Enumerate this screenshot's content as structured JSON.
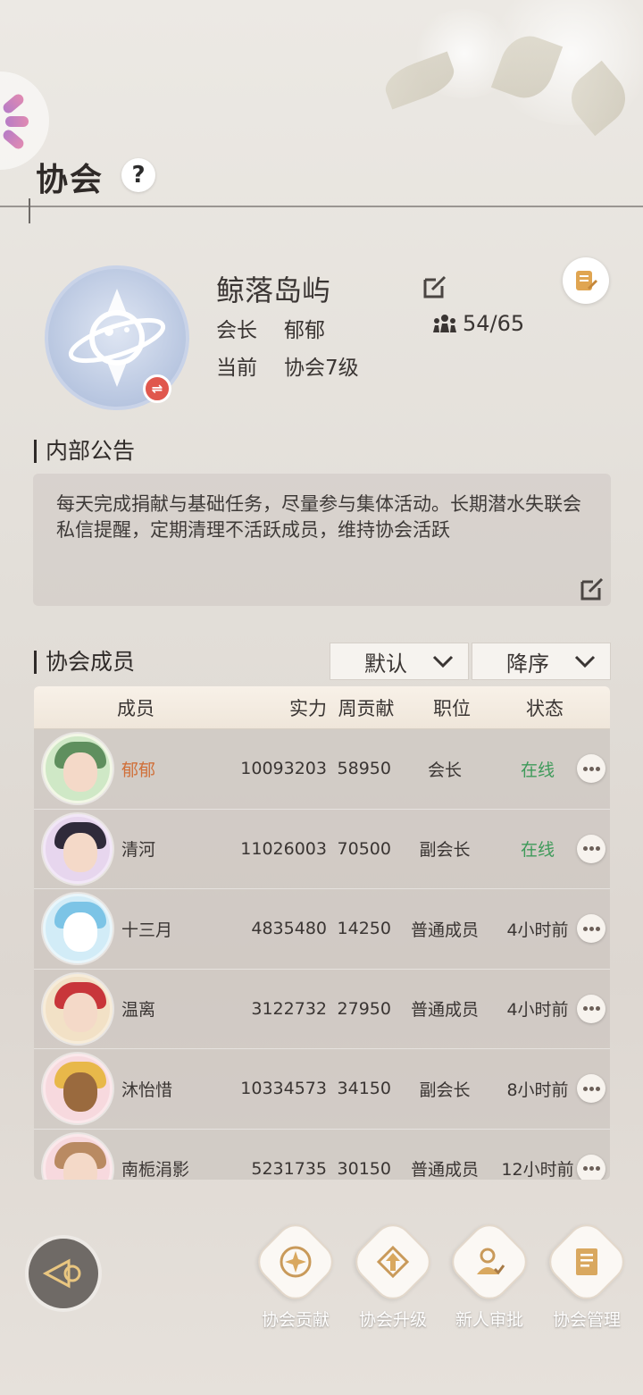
{
  "header": {
    "title": "协会",
    "help_label": "?"
  },
  "guild": {
    "name": "鲸落岛屿",
    "leader_key": "会长",
    "leader_value": "郁郁",
    "level_key": "当前",
    "level_value": "协会7级",
    "member_count": "54/65",
    "swap_label": "⇌"
  },
  "notice": {
    "title": "内部公告",
    "text": "每天完成捐献与基础任务，尽量参与集体活动。长期潜水失联会私信提醒，定期清理不活跃成员，维持协会活跃"
  },
  "members": {
    "title": "协会成员",
    "sort_field": "默认",
    "sort_order": "降序",
    "columns": [
      "成员",
      "实力",
      "周贡献",
      "职位",
      "状态"
    ],
    "rows": [
      {
        "name": "郁郁",
        "power": "10093203",
        "weekly": "58950",
        "position": "会长",
        "status": "在线",
        "name_color": "#d0703a",
        "status_color": "#3e9a5a"
      },
      {
        "name": "清河",
        "power": "11026003",
        "weekly": "70500",
        "position": "副会长",
        "status": "在线",
        "name_color": "#3a3533",
        "status_color": "#3e9a5a"
      },
      {
        "name": "十三月",
        "power": "4835480",
        "weekly": "14250",
        "position": "普通成员",
        "status": "4小时前",
        "name_color": "#3a3533",
        "status_color": "#3a3533"
      },
      {
        "name": "温离",
        "power": "3122732",
        "weekly": "27950",
        "position": "普通成员",
        "status": "4小时前",
        "name_color": "#3a3533",
        "status_color": "#3a3533"
      },
      {
        "name": "沐怡惜",
        "power": "10334573",
        "weekly": "34150",
        "position": "副会长",
        "status": "8小时前",
        "name_color": "#3a3533",
        "status_color": "#3a3533"
      },
      {
        "name": "南栀涓影",
        "power": "5231735",
        "weekly": "30150",
        "position": "普通成员",
        "status": "12小时前",
        "name_color": "#3a3533",
        "status_color": "#3a3533"
      }
    ]
  },
  "actions": [
    {
      "label": "协会贡献",
      "icon": "star-badge-icon"
    },
    {
      "label": "协会升级",
      "icon": "upgrade-arrow-icon"
    },
    {
      "label": "新人审批",
      "icon": "approval-person-icon"
    },
    {
      "label": "协会管理",
      "icon": "management-book-icon"
    }
  ]
}
